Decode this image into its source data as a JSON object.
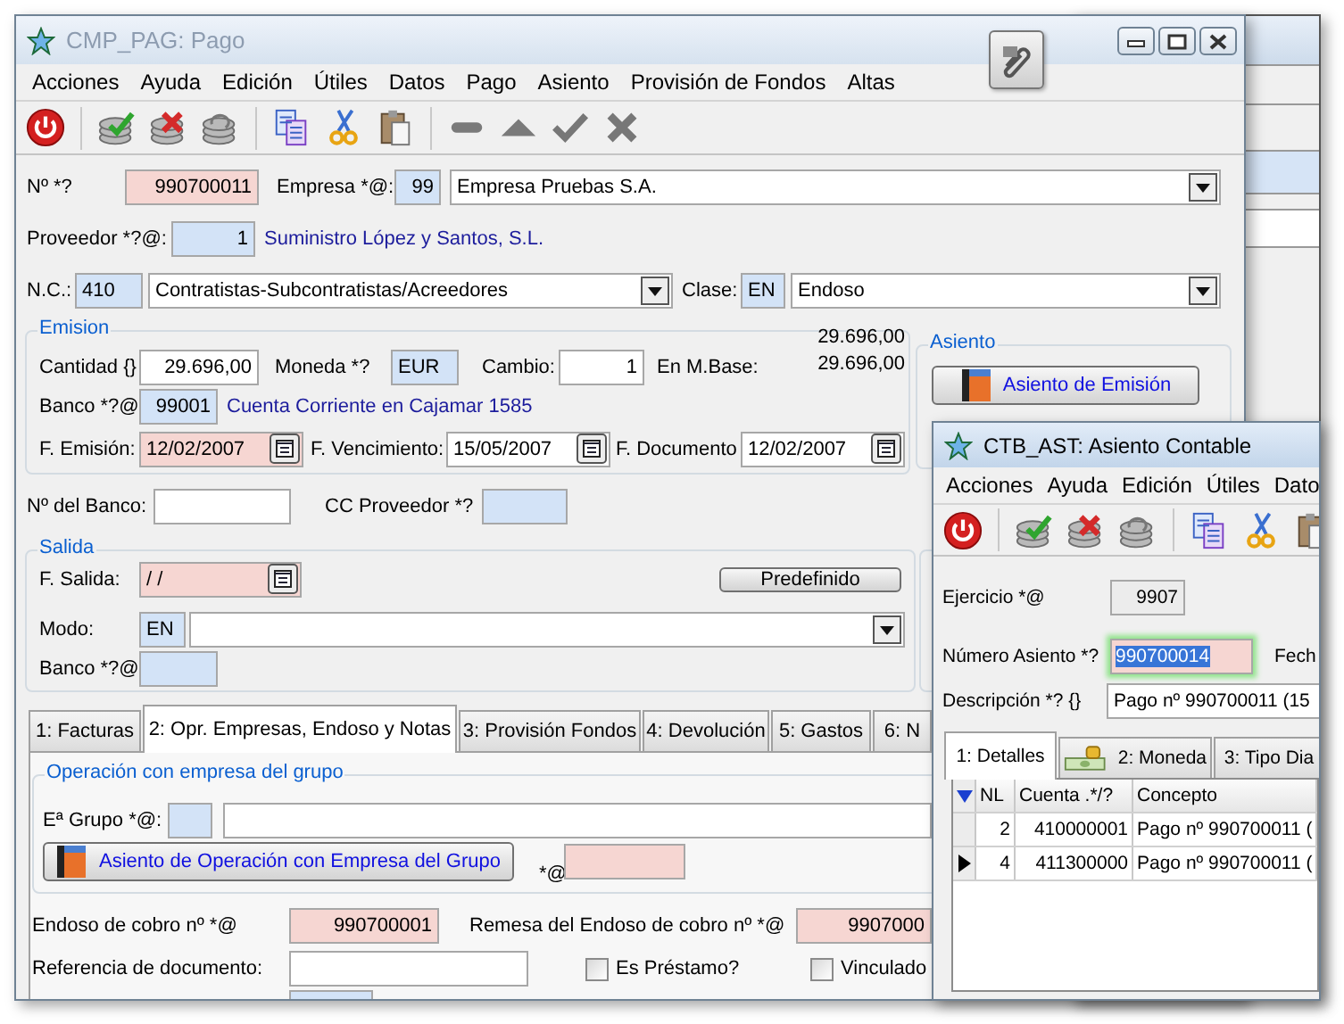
{
  "main_window": {
    "title": "CMP_PAG: Pago",
    "active": false,
    "menu": [
      "Acciones",
      "Ayuda",
      "Edición",
      "Útiles",
      "Datos",
      "Pago",
      "Asiento",
      "Provisión de Fondos",
      "Altas"
    ],
    "header": {
      "numero_label": "Nº *?",
      "numero": "990700011",
      "empresa_label": "Empresa *@:",
      "empresa_code": "99",
      "empresa_name": "Empresa Pruebas S.A.",
      "proveedor_label": "Proveedor *?@:",
      "proveedor_code": "1",
      "proveedor_name": "Suministro López y Santos, S.L.",
      "nc_label": "N.C.:",
      "nc_code": "410",
      "nc_name": "Contratistas-Subcontratistas/Acreedores",
      "clase_label": "Clase:",
      "clase_code": "EN",
      "clase_name": "Endoso"
    },
    "emision": {
      "legend": "Emision",
      "cantidad_label": "Cantidad {}",
      "cantidad": "29.696,00",
      "moneda_label": "Moneda *?",
      "moneda": "EUR",
      "cambio_label": "Cambio:",
      "cambio": "1",
      "base_label": "En M.Base:",
      "totals": [
        "29.696,00",
        "29.696,00"
      ],
      "banco_label": "Banco *?@",
      "banco_code": "99001",
      "banco_name": "Cuenta Corriente en Cajamar 1585",
      "dates": [
        {
          "label": "F. Emisión:",
          "value": "12/02/2007"
        },
        {
          "label": "F. Vencimiento:",
          "value": "15/05/2007"
        },
        {
          "label": "F. Documento",
          "value": "12/02/2007"
        }
      ]
    },
    "asiento": {
      "legend": "Asiento",
      "button": "Asiento de Emisión"
    },
    "banco": {
      "numero_label": "Nº del Banco:",
      "cc_label": "CC Proveedor *?"
    },
    "salida": {
      "legend": "Salida",
      "fecha_label": "F. Salida:",
      "fecha": " / /",
      "button": "Predefinido",
      "modo_label": "Modo:",
      "modo_code": "EN",
      "banco_label": "Banco *?@"
    },
    "tabs": [
      {
        "label": "1: Facturas",
        "selected": false
      },
      {
        "label": "2: Opr. Empresas, Endoso y Notas",
        "selected": true
      },
      {
        "label": "3: Provisión Fondos",
        "selected": false
      },
      {
        "label": "4: Devolución",
        "selected": false
      },
      {
        "label": "5: Gastos",
        "selected": false
      },
      {
        "label": "6: N",
        "selected": false
      }
    ],
    "operacion": {
      "legend": "Operación con empresa del grupo",
      "grupo_label": "Eª Grupo *@:",
      "button": "Asiento de Operación con Empresa del Grupo",
      "extra_label": "*@"
    },
    "endoso": {
      "label": "Endoso de cobro nº *@",
      "value": "990700001",
      "remesa_label": "Remesa del Endoso de cobro nº *@",
      "remesa": "9907000"
    },
    "referencia_label": "Referencia de documento:",
    "checkboxes": [
      {
        "label": "Es Préstamo?",
        "checked": false
      },
      {
        "label": "Vinculado",
        "checked": false
      }
    ]
  },
  "asiento_window": {
    "title": "CTB_AST: Asiento Contable",
    "active": true,
    "menu": [
      "Acciones",
      "Ayuda",
      "Edición",
      "Útiles",
      "Dato"
    ],
    "ejercicio_label": "Ejercicio *@",
    "ejercicio": "9907",
    "numero_label": "Número Asiento *?",
    "numero": "990700014",
    "fecha_label": "Fech",
    "descripcion_label": "Descripción *? {}",
    "descripcion": "Pago nº 990700011 (15",
    "tabs": [
      {
        "label": "1: Detalles",
        "selected": true
      },
      {
        "label": "2: Moneda",
        "selected": false
      },
      {
        "label": "3: Tipo Dia",
        "selected": false
      }
    ],
    "grid": {
      "columns": [
        "NL",
        "Cuenta .*/?",
        "Concepto"
      ],
      "rows": [
        {
          "nl": "2",
          "cuenta": "410000001",
          "concepto": "Pago nº 990700011 (",
          "selected": false
        },
        {
          "nl": "4",
          "cuenta": "411300000",
          "concepto": "Pago nº 990700011 (",
          "selected": true
        }
      ]
    }
  }
}
